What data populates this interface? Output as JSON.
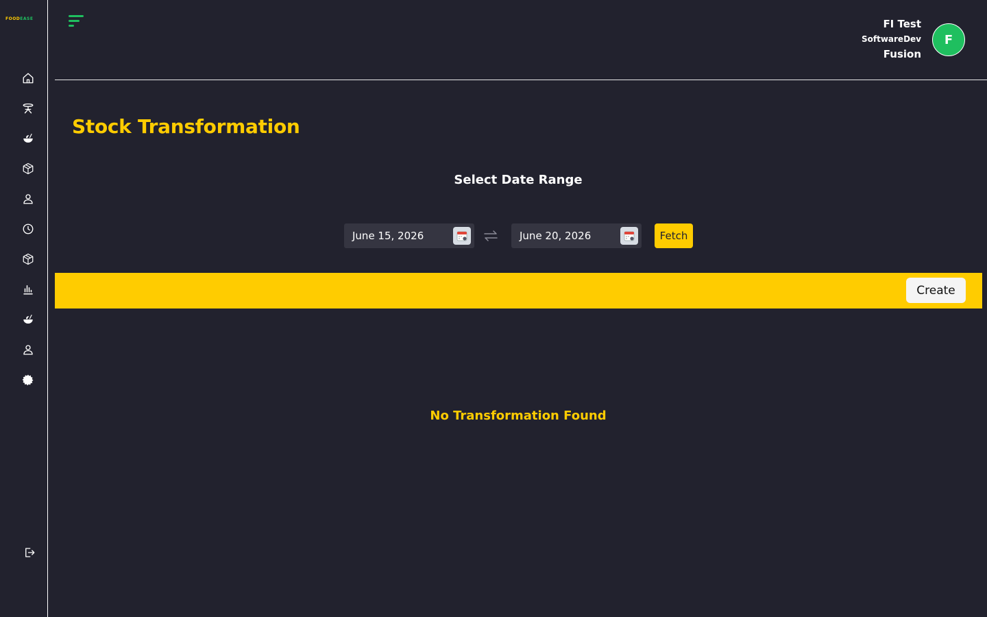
{
  "app": {
    "logo_line1": "FOOD",
    "logo_line2": "EASE"
  },
  "sidebar": {
    "items": [
      {
        "icon": "home-icon"
      },
      {
        "icon": "dining-table-icon"
      },
      {
        "icon": "food-bowl-icon"
      },
      {
        "icon": "box-icon"
      },
      {
        "icon": "user-icon"
      },
      {
        "icon": "clock-icon"
      },
      {
        "icon": "box-icon"
      },
      {
        "icon": "bar-chart-icon"
      },
      {
        "icon": "food-bowl-icon"
      },
      {
        "icon": "user-icon"
      },
      {
        "icon": "gear-icon"
      }
    ],
    "logout_icon": "logout-icon"
  },
  "header": {
    "user_name": "FI Test",
    "user_role": "SoftwareDev",
    "org_name": "Fusion",
    "avatar_letter": "F"
  },
  "page": {
    "title": "Stock Transformation",
    "date_range_label": "Select Date Range",
    "start_date": "June 15, 2026",
    "end_date": "June 20, 2026",
    "fetch_label": "Fetch",
    "create_label": "Create",
    "empty_message": "No Transformation Found"
  },
  "colors": {
    "background": "#22222e",
    "accent": "#ffcc00",
    "brand_green": "#1fbf5f"
  }
}
